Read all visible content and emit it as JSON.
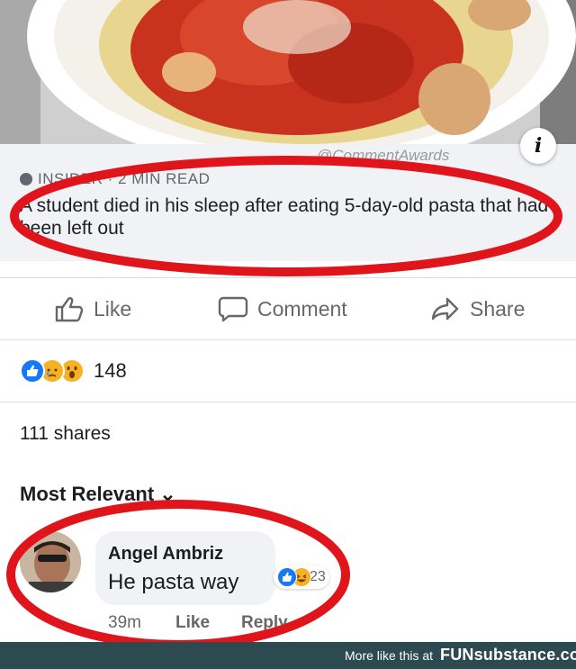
{
  "watermark": "@CommentAwards",
  "link_card": {
    "source": "INSIDER · 2 MIN READ",
    "headline": "A student died in his sleep after eating 5-day-old pasta that had been left out"
  },
  "actions": {
    "like": "Like",
    "comment": "Comment",
    "share": "Share"
  },
  "reactions": {
    "types": [
      "like",
      "sad",
      "wow"
    ],
    "count": "148"
  },
  "shares": "111 shares",
  "sort_label": "Most Relevant",
  "comment": {
    "author": "Angel Ambriz",
    "text": "He pasta way",
    "reaction_count": "23",
    "time": "39m",
    "like": "Like",
    "reply": "Reply"
  },
  "footer": {
    "more": "More like this at",
    "brand": "FUNsubstance.com"
  },
  "colors": {
    "annotation": "#e0151b",
    "facebook_blue": "#1877f2",
    "footer_bg": "#2d4a51"
  }
}
